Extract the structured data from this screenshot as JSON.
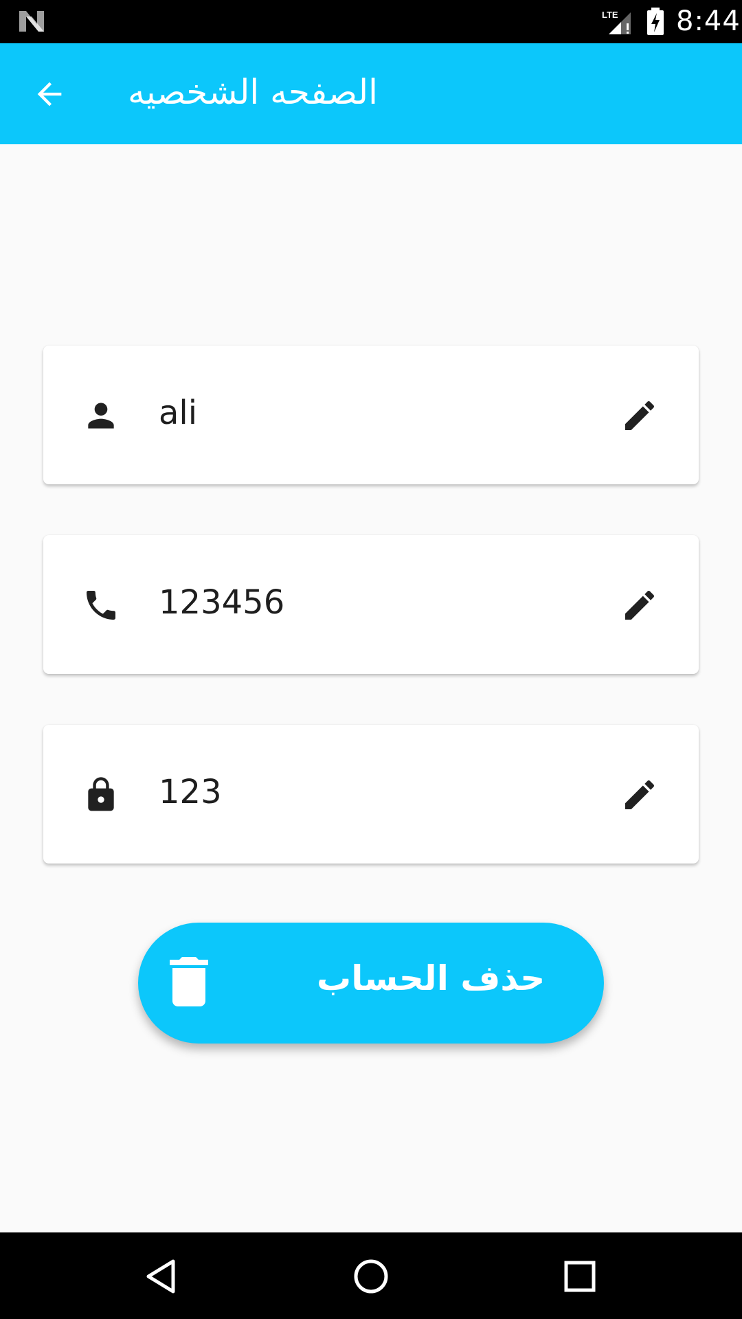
{
  "status_bar": {
    "time": "8:44",
    "network": "LTE",
    "icons": [
      "n-logo-icon",
      "lte-signal-icon",
      "battery-charging-icon"
    ]
  },
  "app_bar": {
    "title": "الصفحه الشخصيه",
    "back_icon": "arrow-back-icon",
    "background": "#0cc7fb"
  },
  "fields": [
    {
      "icon": "person-icon",
      "value": "ali",
      "edit_icon": "pencil-icon"
    },
    {
      "icon": "phone-icon",
      "value": "123456",
      "edit_icon": "pencil-icon"
    },
    {
      "icon": "lock-icon",
      "value": "123",
      "edit_icon": "pencil-icon"
    }
  ],
  "delete_button": {
    "label": "حذف الحساب",
    "icon": "trash-icon",
    "color": "#0cc7fb"
  },
  "nav_bar": {
    "icons": [
      "back-triangle-icon",
      "home-circle-icon",
      "recents-square-icon"
    ]
  }
}
